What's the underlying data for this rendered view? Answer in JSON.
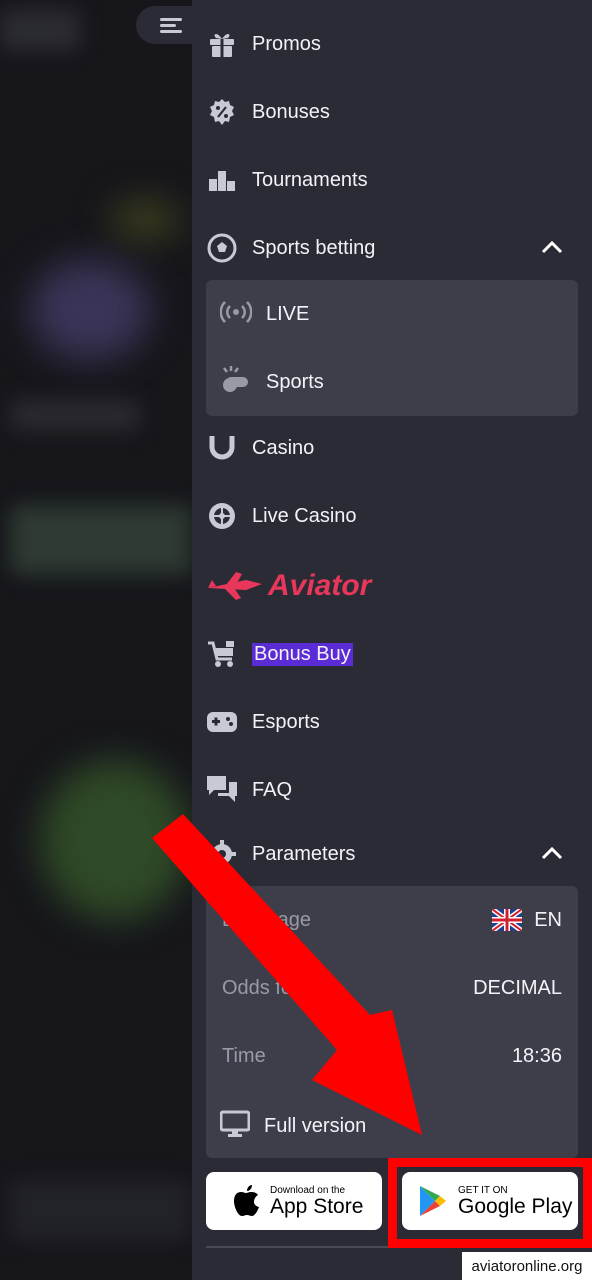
{
  "menu": {
    "items": [
      {
        "label": "Promos",
        "icon": "gift-icon"
      },
      {
        "label": "Bonuses",
        "icon": "percent-badge-icon"
      },
      {
        "label": "Tournaments",
        "icon": "podium-icon"
      },
      {
        "label": "Sports betting",
        "icon": "soccer-ball-icon"
      },
      {
        "label": "Casino",
        "icon": "horseshoe-icon"
      },
      {
        "label": "Live Casino",
        "icon": "roulette-icon"
      },
      {
        "label": "Bonus Buy",
        "icon": "cart-icon"
      },
      {
        "label": "Esports",
        "icon": "gamepad-icon"
      },
      {
        "label": "FAQ",
        "icon": "chat-bubbles-icon"
      },
      {
        "label": "Parameters",
        "icon": "gear-icon"
      }
    ],
    "sports_sub": [
      {
        "label": "LIVE",
        "icon": "broadcast-icon"
      },
      {
        "label": "Sports",
        "icon": "whistle-icon"
      }
    ],
    "aviator_label": "Aviator"
  },
  "parameters": {
    "language_label": "Language",
    "language_value": "EN",
    "odds_label": "Odds format",
    "odds_value": "DECIMAL",
    "time_label": "Time",
    "time_value": "18:36",
    "full_version_label": "Full version"
  },
  "stores": {
    "apple_small": "Download on the",
    "apple_big": "App Store",
    "google_small": "GET IT ON",
    "google_big": "Google Play"
  },
  "watermark": "aviatoronline.org",
  "colors": {
    "drawer_bg": "#2b2b35",
    "submenu_bg": "#3e3e4b",
    "aviator_red": "#e8375a",
    "highlight": "#5b2bd6",
    "arrow_red": "#ff0000"
  }
}
